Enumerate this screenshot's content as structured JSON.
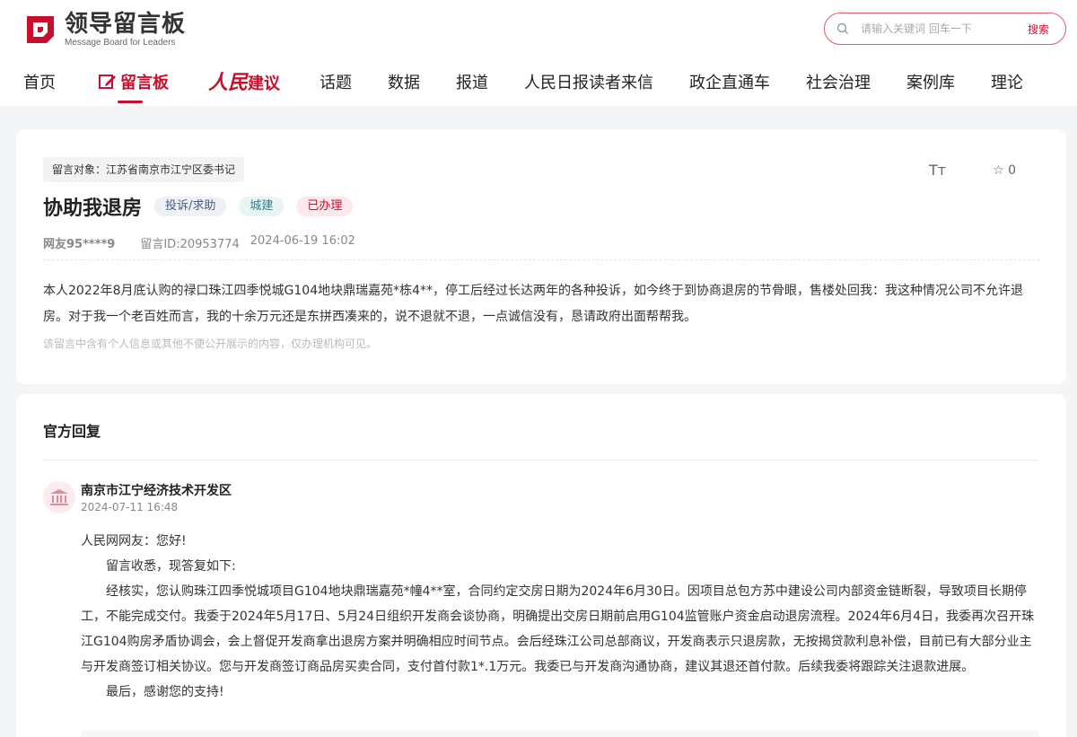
{
  "header": {
    "logo_title": "领导留言板",
    "logo_subtitle": "Message Board for Leaders",
    "search_placeholder": "请输入关键词 回车一下",
    "search_button": "搜索",
    "accent_color": "#c8102e"
  },
  "nav": {
    "items": [
      {
        "label": "首页"
      },
      {
        "label": "留言板",
        "active": true
      },
      {
        "label_a": "人民",
        "label_b": "建议"
      },
      {
        "label": "话题"
      },
      {
        "label": "数据"
      },
      {
        "label": "报道"
      },
      {
        "label": "人民日报读者来信"
      },
      {
        "label": "政企直通车"
      },
      {
        "label": "社会治理"
      },
      {
        "label": "案例库"
      },
      {
        "label": "理论"
      }
    ]
  },
  "message": {
    "target": "留言对象：江苏省南京市江宁区委书记",
    "title": "协助我退房",
    "tags": [
      "投诉/求助",
      "城建",
      "已办理"
    ],
    "favorite_count": "0",
    "font_size_icon": "Tт",
    "user": "网友95****9",
    "message_id": "留言ID:20953774",
    "time": "2024-06-19 16:02",
    "content": "本人2022年8月底认购的禄口珠江四季悦城G104地块鼎瑞嘉苑*栋4**，停工后经过长达两年的各种投诉，如今终于到协商退房的节骨眼，售楼处回我：我这种情况公司不允许退房。对于我一个老百姓而言，我的十余万元还是东拼西凑来的，说不退就不退，一点诚信没有，恳请政府出面帮帮我。",
    "privacy_note": "该留言中含有个人信息或其他不便公开展示的内容，仅办理机构可见。"
  },
  "reply": {
    "heading": "官方回复",
    "department": "南京市江宁经济技术开发区",
    "date": "2024-07-11 16:48",
    "greeting": "人民网网友：您好!",
    "para1": "留言收悉，现答复如下:",
    "para2": "经核实，您认购珠江四季悦城项目G104地块鼎瑞嘉苑*幢4**室，合同约定交房日期为2024年6月30日。因项目总包方苏中建设公司内部资金链断裂，导致项目长期停工，不能完成交付。我委于2024年5月17日、5月24日组织开发商会谈协商，明确提出交房日期前启用G104监管账户资金启动退房流程。2024年6月4日，我委再次召开珠江G104购房矛盾协调会，会上督促开发商拿出退房方案并明确相应时间节点。会后经珠江公司总部商议，开发商表示只退房款，无按揭贷款利息补偿，目前已有大部分业主与开发商签订相关协议。您与开发商签订商品房买卖合同，支付首付款1*.1万元。我委已与开发商沟通协商，建议其退还首付款。后续我委将跟踪关注退款进展。",
    "para3": "最后，感谢您的支持!"
  }
}
